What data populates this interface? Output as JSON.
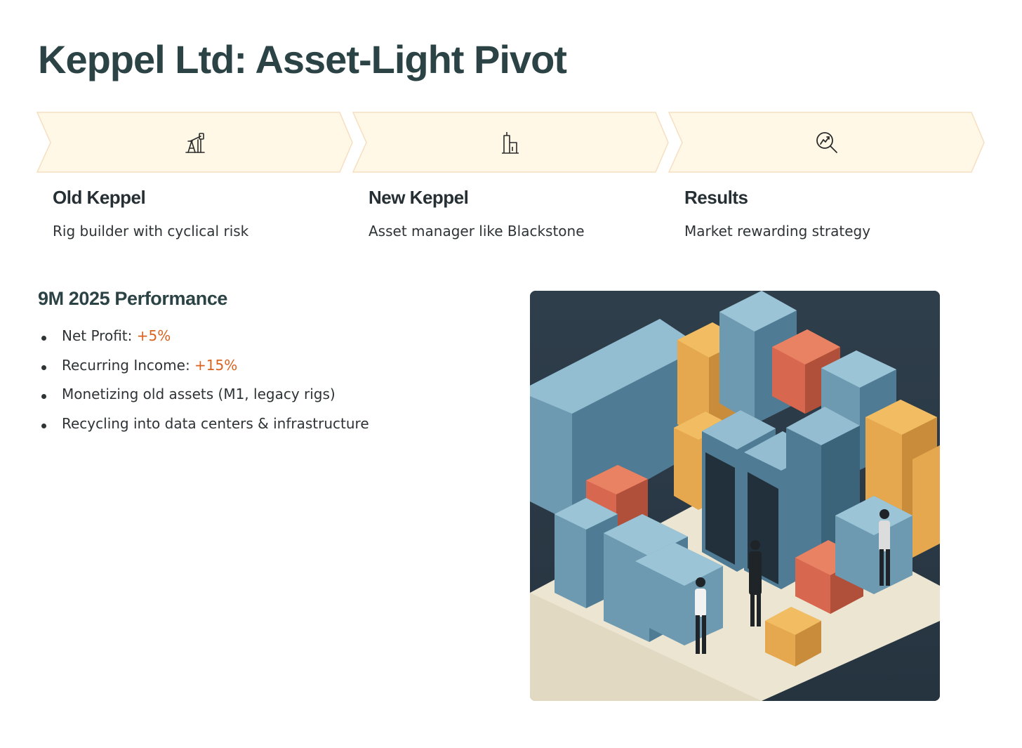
{
  "title": "Keppel Ltd: Asset-Light Pivot",
  "colors": {
    "title": "#2c4346",
    "chevron_fill": "#fff8e6",
    "chevron_stroke": "#f6dfc0",
    "accent": "#d9621f",
    "text": "#2e3436"
  },
  "steps": [
    {
      "icon": "oil-pump-icon",
      "title": "Old Keppel",
      "desc": "Rig builder with cyclical risk"
    },
    {
      "icon": "building-icon",
      "title": "New Keppel",
      "desc": "Asset manager like Blackstone"
    },
    {
      "icon": "magnify-chart-icon",
      "title": "Results",
      "desc": "Market rewarding strategy"
    }
  ],
  "performance": {
    "heading": "9M 2025 Performance",
    "items": [
      {
        "label": "Net Profit: ",
        "value": "+5%"
      },
      {
        "label": "Recurring Income: ",
        "value": "+15%"
      },
      {
        "label": "Monetizing old assets (M1, legacy rigs)",
        "value": ""
      },
      {
        "label": "Recycling into data centers & infrastructure",
        "value": ""
      }
    ]
  },
  "illustration": {
    "icon": "data-center-illustration"
  }
}
